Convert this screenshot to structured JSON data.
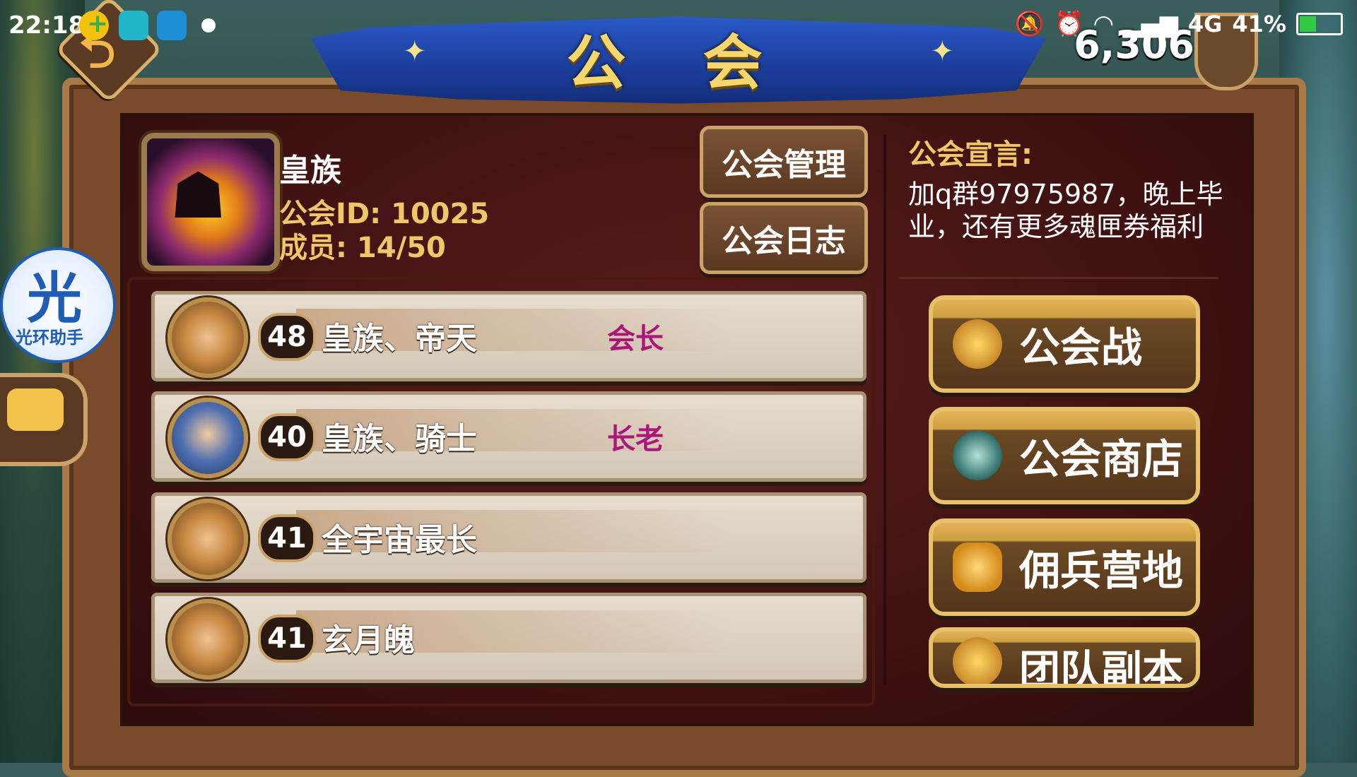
{
  "status_bar": {
    "time": "22:18",
    "network": "4G",
    "battery": "41%",
    "battery_level": 0.41,
    "icons": [
      "plus-circle-icon",
      "scan-icon",
      "battery-app-icon",
      "dot-icon",
      "bell-off-icon",
      "alarm-icon",
      "wifi-icon",
      "signal-icon"
    ]
  },
  "header": {
    "title": "公 会",
    "currency_amount": "6,306"
  },
  "guild": {
    "name": "皇族",
    "id_label": "公会ID: 10025",
    "members_label": "成员: 14/50",
    "manage_button": "公会管理",
    "log_button": "公会日志"
  },
  "members": [
    {
      "level": "48",
      "name": "皇族、帝天",
      "rank": "会长",
      "avatar": "warrior-avatar"
    },
    {
      "level": "40",
      "name": "皇族、骑士",
      "rank": "长老",
      "avatar": "knight-avatar"
    },
    {
      "level": "41",
      "name": "全宇宙最长",
      "rank": "",
      "avatar": "warrior-avatar"
    },
    {
      "level": "41",
      "name": "玄月魄",
      "rank": "",
      "avatar": "warrior-avatar"
    }
  ],
  "declaration": {
    "title": "公会宣言:",
    "text": "加q群97975987，晚上毕业，还有更多魂匣券福利"
  },
  "features": {
    "guild_war": "公会战",
    "guild_shop": "公会商店",
    "mercenary_camp": "佣兵营地",
    "team_dungeon": "团队副本"
  },
  "helper": {
    "glyph": "光",
    "label": "光环助手"
  },
  "colors": {
    "accent_gold": "#f0c66a",
    "rank_purple": "#a8177a",
    "banner_blue": "#1b3d9a"
  }
}
